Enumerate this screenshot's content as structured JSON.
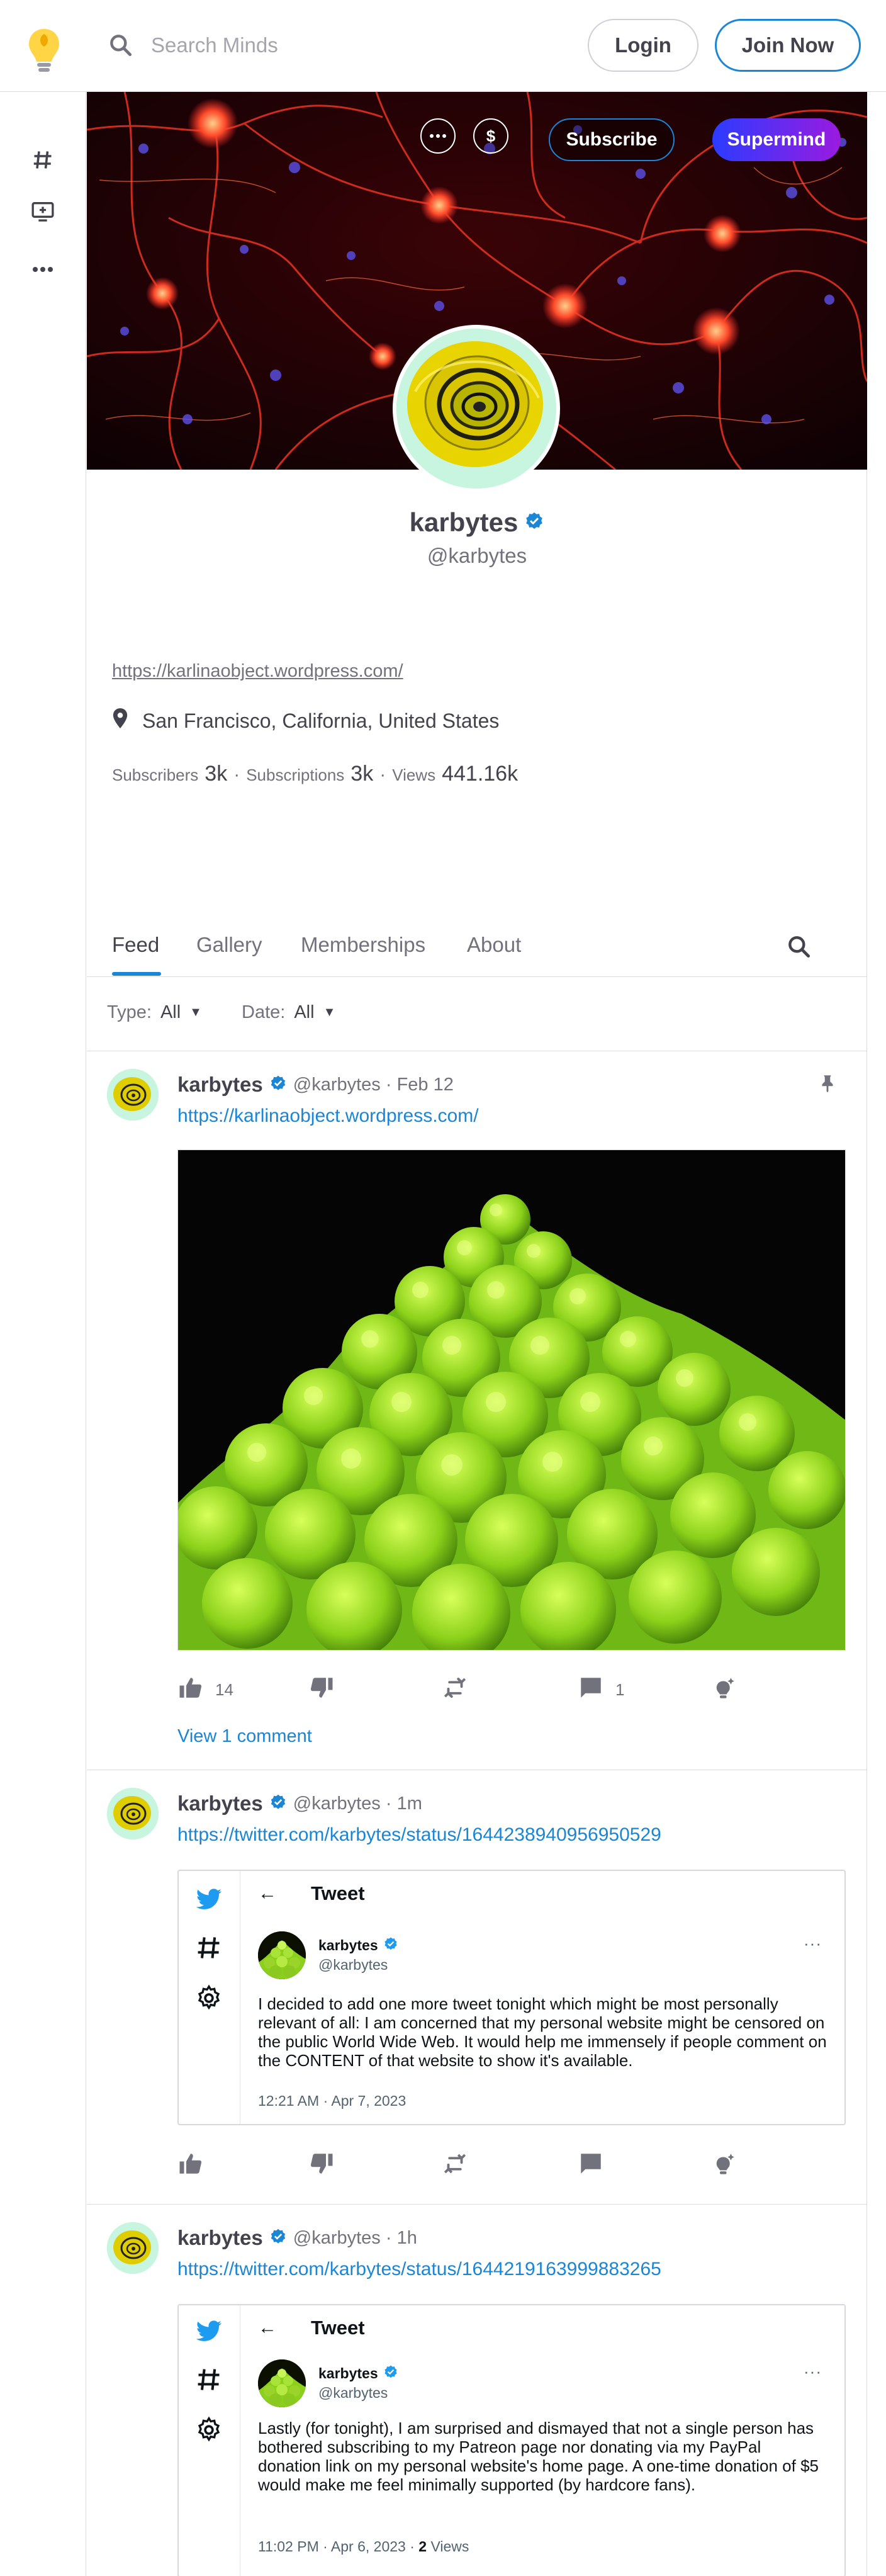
{
  "header": {
    "search_placeholder": "Search Minds",
    "login_label": "Login",
    "join_label": "Join Now"
  },
  "rail": {
    "items": [
      "hashtag-icon",
      "monitor-plus-icon",
      "more-horizontal-icon"
    ]
  },
  "banner": {
    "subscribe_label": "Subscribe",
    "supermind_label": "Supermind",
    "more_icon": "more-horizontal-icon",
    "wallet_icon": "dollar-icon"
  },
  "profile": {
    "name": "karbytes",
    "handle": "@karbytes",
    "website": "https://karlinaobject.wordpress.com/",
    "location": "San Francisco, California, United States",
    "stats": {
      "subscribers_label": "Subscribers",
      "subscribers_value": "3k",
      "subscriptions_label": "Subscriptions",
      "subscriptions_value": "3k",
      "views_label": "Views",
      "views_value": "441.16k",
      "separator": "·"
    }
  },
  "tabs": [
    "Feed",
    "Gallery",
    "Memberships",
    "About"
  ],
  "filters": {
    "type_label": "Type:",
    "type_value": "All",
    "date_label": "Date:",
    "date_value": "All"
  },
  "posts": [
    {
      "name": "karbytes",
      "meta": "@karbytes · Feb 12",
      "link": "https://karlinaobject.wordpress.com/",
      "pinned": true,
      "up_count": "14",
      "comment_count": "1",
      "view_comments": "View 1 comment"
    },
    {
      "name": "karbytes",
      "meta": "@karbytes · 1m",
      "link": "https://twitter.com/karbytes/status/1644238940956950529",
      "tweet": {
        "title": "Tweet",
        "back": "←",
        "name": "karbytes",
        "handle": "@karbytes",
        "more": "···",
        "text": "I decided to add one more tweet tonight which might be most personally relevant of all: I am concerned that my personal website might be censored on the public World Wide Web. It would help me immensely if people comment on the CONTENT of that website to show it's available.",
        "time": "12:21 AM · Apr 7, 2023"
      }
    },
    {
      "name": "karbytes",
      "meta": "@karbytes · 1h",
      "link": "https://twitter.com/karbytes/status/1644219163999883265",
      "tweet": {
        "title": "Tweet",
        "back": "←",
        "name": "karbytes",
        "handle": "@karbytes",
        "more": "···",
        "text": "Lastly (for tonight), I am surprised and dismayed that not a single person has bothered subscribing to my Patreon page nor donating via my PayPal donation link on my personal website's home page. A one-time donation of $5 would make me feel minimally supported (by hardcore fans).",
        "time": "11:02 PM · Apr 6, 2023 · ",
        "views_count": "2",
        "views_label": "Views"
      }
    }
  ],
  "colors": {
    "accent": "#1b85d6",
    "text": "#43434d",
    "muted": "#72727d",
    "supermind_start": "#2b3cff",
    "supermind_end": "#9b1ae0"
  }
}
